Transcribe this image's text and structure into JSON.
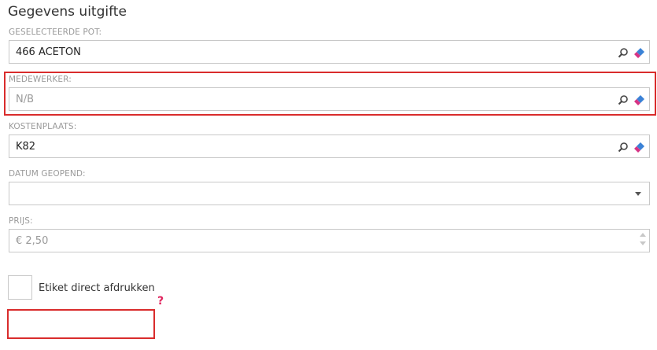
{
  "page": {
    "title": "Gegevens uitgifte"
  },
  "fields": {
    "pot": {
      "label": "GESELECTEERDE POT:",
      "value": "466 ACETON"
    },
    "medewerker": {
      "label": "MEDEWERKER:",
      "value": "N/B"
    },
    "kostenplaats": {
      "label": "KOSTENPLAATS:",
      "value": "K82"
    },
    "datum": {
      "label": "DATUM GEOPEND:",
      "value": ""
    },
    "prijs": {
      "label": "PRIJS:",
      "placeholder": "€ 2,50"
    }
  },
  "print": {
    "label": "Etiket direct afdrukken",
    "checked": false,
    "help_glyph": "?"
  },
  "colors": {
    "highlight": "#d92c2c",
    "help": "#e0245e",
    "eraser_blue": "#3b82d6",
    "eraser_pink": "#d63384"
  },
  "icons": [
    "search-icon",
    "eraser-icon",
    "chevron-down-icon",
    "spinner-up-icon",
    "spinner-down-icon",
    "help-icon"
  ]
}
